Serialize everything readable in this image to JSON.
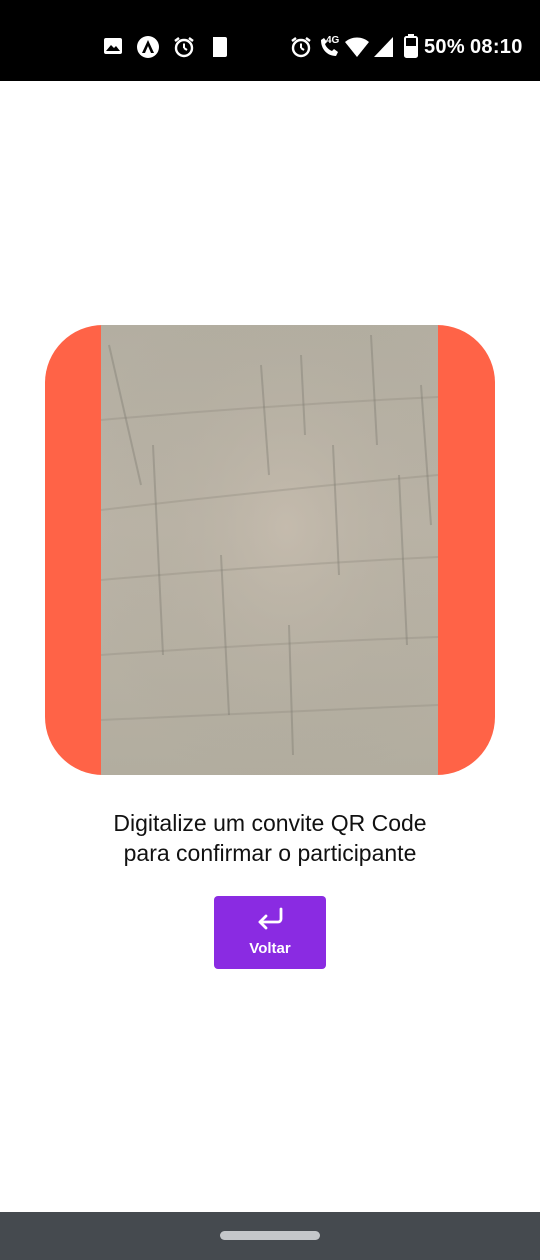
{
  "status_bar": {
    "icons_left": [
      "image-icon",
      "app-logo-icon",
      "alarm-icon",
      "file-icon"
    ],
    "icons_right": [
      "alarm-icon",
      "wifi-calling-4g-icon",
      "wifi-icon",
      "signal-icon",
      "battery-icon"
    ],
    "network_label": "4G",
    "battery_percent": "50%",
    "time": "08:10"
  },
  "scanner": {
    "frame_color": "#ff6347"
  },
  "instructions": {
    "line1": "Digitalize um convite QR Code",
    "line2": "para confirmar o participante"
  },
  "back_button": {
    "label": "Voltar",
    "icon": "return-arrow-icon",
    "color": "#8a2be2"
  }
}
